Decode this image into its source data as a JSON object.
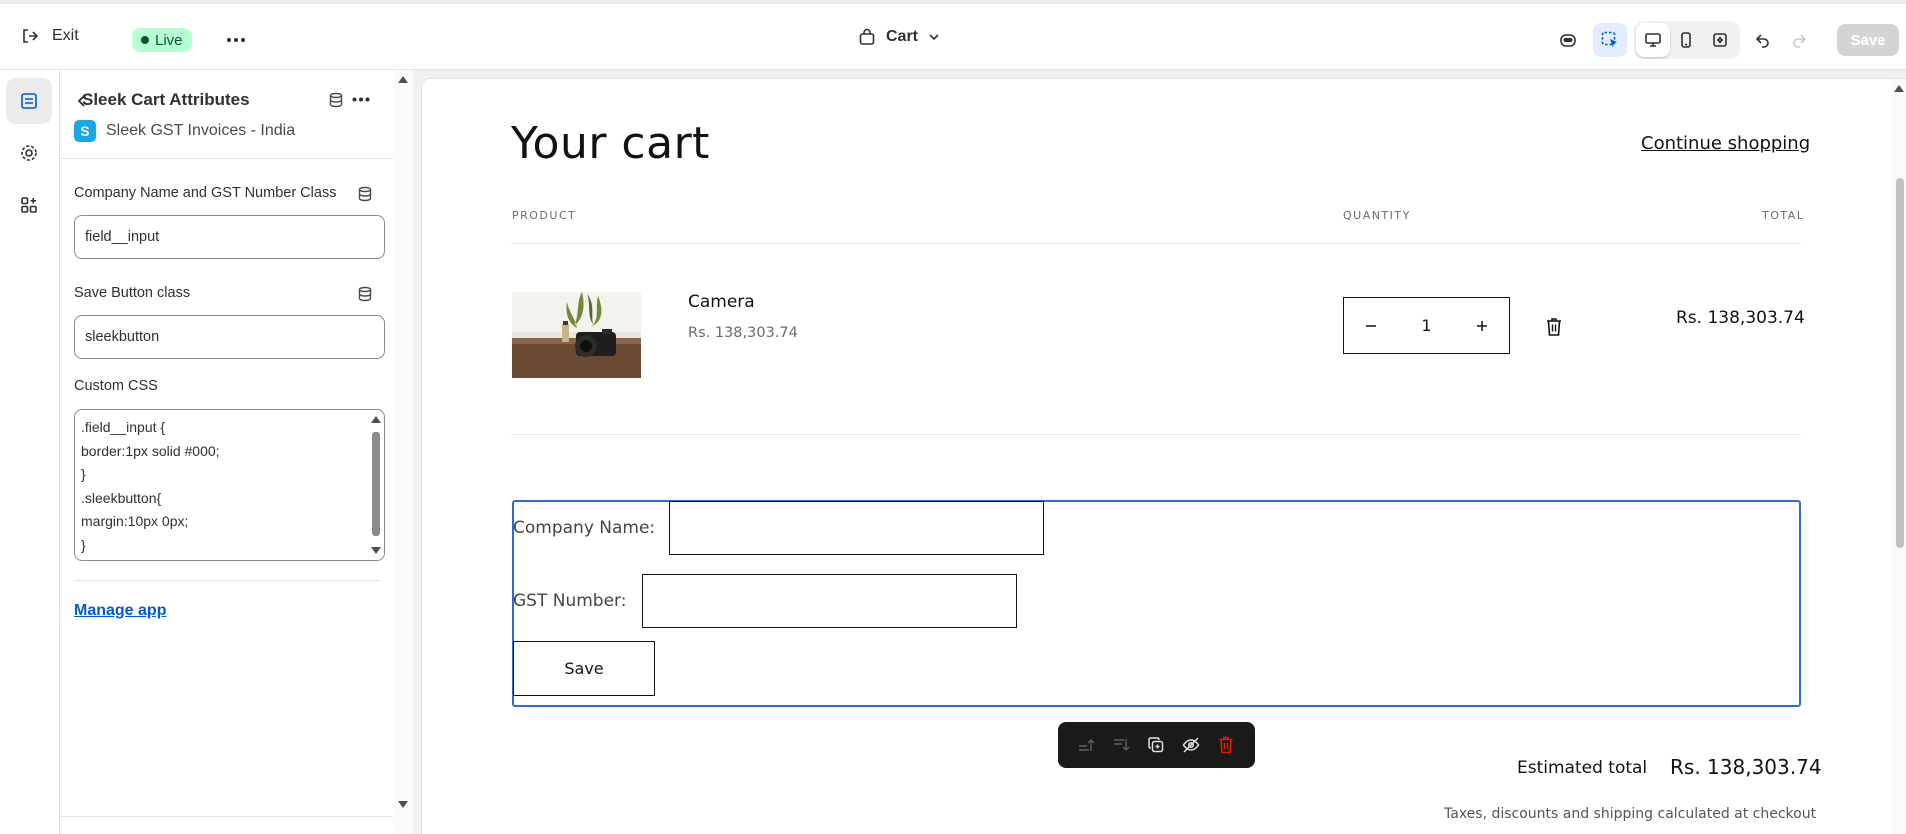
{
  "topbar": {
    "exit_label": "Exit",
    "live_label": "Live",
    "template_label": "Cart",
    "save_label": "Save",
    "icons": [
      "exit-icon",
      "more-icon",
      "bag-icon",
      "chevron-down-icon",
      "sidekick-icon",
      "inspector-icon",
      "desktop-icon",
      "mobile-icon",
      "fullscreen-icon",
      "undo-icon",
      "redo-icon"
    ]
  },
  "rail": {
    "items": [
      "sections-icon",
      "settings-icon",
      "apps-icon"
    ]
  },
  "panel": {
    "title": "Sleek Cart Attributes",
    "app_name": "Sleek GST Invoices - India",
    "app_badge": "S",
    "fields": [
      {
        "label": "Company Name and GST Number Class",
        "value": "field__input"
      },
      {
        "label": "Save Button class",
        "value": "sleekbutton"
      }
    ],
    "custom_css_label": "Custom CSS",
    "custom_css_lines": [
      ".field__input {",
      "border:1px solid #000;",
      "}",
      ".sleekbutton{",
      "margin:10px 0px;",
      "}"
    ],
    "manage_app": "Manage app"
  },
  "cart": {
    "title": "Your cart",
    "continue": "Continue shopping",
    "headers": {
      "product": "PRODUCT",
      "quantity": "QUANTITY",
      "total": "TOTAL"
    },
    "item": {
      "name": "Camera",
      "price": "Rs. 138,303.74",
      "quantity": "1",
      "total": "Rs. 138,303.74"
    },
    "form": {
      "company_label": "Company Name:",
      "gst_label": "GST Number:",
      "save_label": "Save"
    },
    "estimated_label": "Estimated total",
    "estimated_value": "Rs. 138,303.74",
    "tax_note": "Taxes, discounts and shipping calculated at checkout"
  },
  "colors": {
    "accent": "#2c6ecb",
    "live_bg": "#b4fed2",
    "link": "#005bd3",
    "delete": "#e51c00"
  }
}
